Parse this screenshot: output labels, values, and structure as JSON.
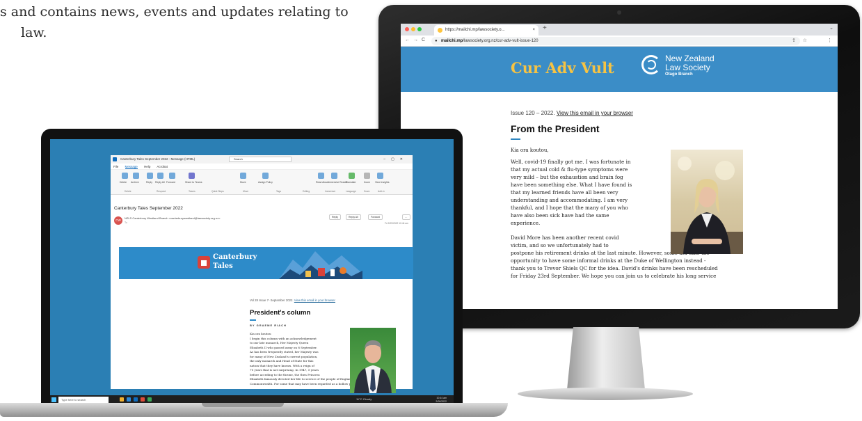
{
  "intro": {
    "line1": "s and contains news, events and updates relating to",
    "line2": "law."
  },
  "imac_browser": {
    "tab_title": "https://mailchi.mp/lawsociety.o...",
    "tab_close": "×",
    "new_tab": "+",
    "tab_chevron": "⌄",
    "nav_back": "←",
    "nav_forward": "→",
    "nav_reload": "C",
    "url_domain": "mailchi.mp",
    "url_path": "/lawsociety.org.nz/cur-adv-vult-issue-120",
    "menu_dots": "⋮",
    "newsletter": {
      "title": "Cur Adv Vult",
      "org_line1": "New Zealand",
      "org_line2": "Law Society",
      "org_line3": "Otago Branch",
      "issue_text": "Issue 120 – 2022.",
      "view_link": "View this email in your browser",
      "heading": "From the President",
      "greeting": "Kia ora koutou,",
      "para1": [
        "Well, covid-19 finally got me.  I was fortunate in",
        "that my actual cold & flu-type symptoms were",
        "very mild – but the exhaustion and brain fog",
        "have been something else.  What I have found is",
        "that my learned friends have all been very",
        "understanding and accommodating.  I am very",
        "thankful, and I hope that the many of you who",
        "have also been sick have had the same",
        "experience."
      ],
      "para2": [
        "David More has been another recent covid",
        "victim, and so we unfortunately had to",
        "postpone his retirement drinks at the last minute.  However, some did take the",
        "opportunity to have some informal drinks at the Duke of Wellington instead -",
        "thank you to Trevor Shiels QC for the idea.  David's drinks have been rescheduled",
        "for Friday 23rd September. We hope you can join us to celebrate his long service"
      ]
    }
  },
  "laptop_outlook": {
    "window_title": "Canterbury Tales September 2022 - Message (HTML)",
    "search_placeholder": "Search",
    "window_controls": "–▢✕",
    "menu": [
      "File",
      "Message",
      "Help",
      "Acrobat"
    ],
    "ribbon_buttons": [
      "Delete",
      "Archive",
      "Reply",
      "Reply All",
      "Forward",
      "Share to Teams",
      "Move",
      "Assign Policy",
      "Read Aloud",
      "Immersive Reader",
      "Translate",
      "Zoom",
      "View Insights"
    ],
    "ribbon_groups": [
      "Delete",
      "Respond",
      "Teams",
      "Quick Steps",
      "Move",
      "Tags",
      "Editing",
      "Immersive",
      "Language",
      "Zoom",
      "Add-in"
    ],
    "subject": "Canterbury Tales September 2022",
    "avatar_initials": "CW",
    "from": "NZLS Canterbury Westland Branch <canterburywestland@lawsociety.org.nz>",
    "to": "To",
    "actions": [
      "Reply",
      "Reply All",
      "Forward",
      "…"
    ],
    "date": "Fri 2/09/2022 10:44 am",
    "banner_line1": "Canterbury",
    "banner_line2": "Tales",
    "vol_text": "Vol 28 Issue 7- September 2022.",
    "view_link": "View this email in your browser",
    "heading": "President's column",
    "byline": "BY GRAEME RIACH",
    "body": [
      "Kia ora koutou",
      "I begin this column with an acknowledgement",
      "to our late monarch, Her Majesty Queen",
      "Elizabeth II who passed away on 8 September.",
      "As has been frequently stated, her Majesty was",
      "for many of New Zealand's current population,",
      "the only monarch and Head of State for this",
      "nation that they have known. With a reign of",
      "70 years that is not surprising. In 1947, 5 years",
      "before acceding to the throne, the then Princess",
      "Elizabeth famously devoted her life to service of the people of England and the",
      "Commonwealth. For some that may have been regarded as a hollow promise –"
    ],
    "taskbar": {
      "search_placeholder": "Type here to search",
      "weather": "11°C Cloudy",
      "time": "10:44 am",
      "date": "2/09/2022"
    }
  },
  "colors": {
    "nzls_blue": "#3b8dc7",
    "nl_title_gold": "#f6c343",
    "outlook_blue": "#0f6cbd",
    "banner_blue": "#2d8bc9"
  }
}
